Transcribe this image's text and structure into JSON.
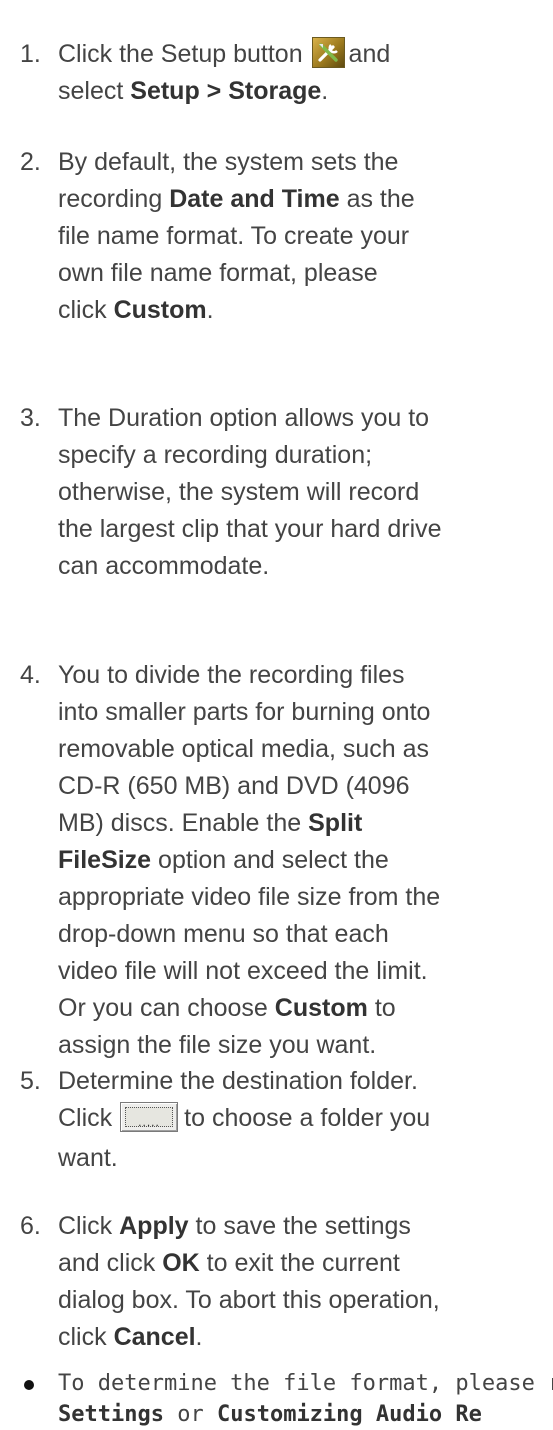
{
  "steps": [
    {
      "number": "1.",
      "lines": [
        [
          "Click the Setup button",
          "[setup-icon]",
          " and"
        ],
        [
          "select ",
          "**Setup > Storage",
          "."
        ]
      ],
      "s1_l1_a": "Click the Setup button",
      "s1_l1_b": "and",
      "s1_l2_a": "select",
      "s1_l2_b": "Setup > Storage",
      "s1_l2_c": "."
    },
    {
      "number": "2.",
      "l1": "By default, the system sets the",
      "l2_a": "recording",
      "l2_b": "Date and Time",
      "l2_c": "as the",
      "l3": "file name format. To create your",
      "l4": "own file name format, please",
      "l5_a": "click",
      "l5_b": "Custom",
      "l5_c": "."
    },
    {
      "number": "3.",
      "l1": "The Duration option allows you to",
      "l2": "specify a recording duration;",
      "l3": "otherwise, the system will record",
      "l4": "the largest clip that your hard drive",
      "l5": "can accommodate."
    },
    {
      "number": "4.",
      "l1": "You to divide the recording files",
      "l2": "into smaller parts for burning onto",
      "l3": "removable optical media, such as",
      "l4": "CD-R (650 MB) and DVD (4096",
      "l5_a": "MB) discs. Enable the",
      "l5_b": "Split",
      "l6_a": "FileSize",
      "l6_b": "option and select the",
      "l7": "appropriate video file size from the",
      "l8": "drop-down menu so that each",
      "l9": "video file will not exceed the limit.",
      "l10_a": "Or you can choose",
      "l10_b": "Custom",
      "l10_c": "to",
      "l11": "assign the file size you want."
    },
    {
      "number": "5.",
      "l1": "Determine the destination folder.",
      "l2_a": "Click",
      "l2_b": "to choose a folder you",
      "l3": "want."
    },
    {
      "number": "6.",
      "l1_a": "Click",
      "l1_b": "Apply",
      "l1_c": "to save the settings",
      "l2_a": "and click",
      "l2_b": "OK",
      "l2_c": "to exit the current",
      "l3": "dialog box. To abort this operation,",
      "l4_a": "click",
      "l4_b": "Cancel",
      "l4_c": "."
    }
  ],
  "note": {
    "l1": "To determine the file format, please r",
    "l2_a": "Settings",
    "l2_b": "or",
    "l2_c": "Customizing Audio Re"
  },
  "icons": {
    "setup": "setup-tools-icon",
    "browse": "browse-folder-button"
  },
  "colors": {
    "text": "#444444",
    "bold": "#333333",
    "setup_icon_bg": "#b08a2a"
  }
}
